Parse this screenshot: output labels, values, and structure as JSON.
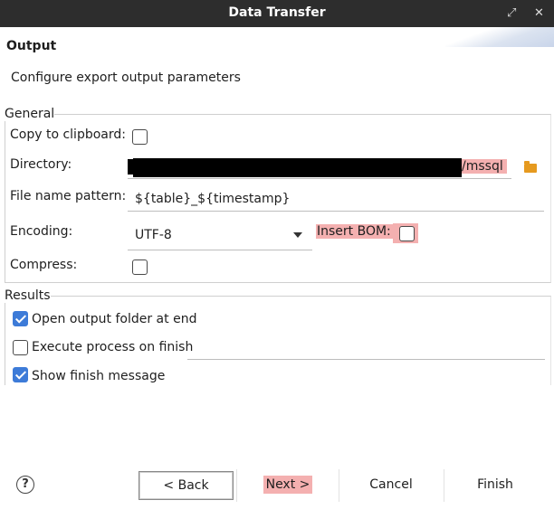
{
  "window": {
    "title": "Data Transfer",
    "icons": [
      "restore-icon",
      "close-icon"
    ]
  },
  "header": {
    "title": "Output",
    "description": "Configure export output parameters"
  },
  "general": {
    "legend": "General",
    "copy_to_clipboard": {
      "label": "Copy to clipboard:",
      "checked": false
    },
    "directory": {
      "label": "Directory:",
      "value_visible": "/mssql",
      "icon": "folder-icon"
    },
    "file_name_pattern": {
      "label": "File name pattern:",
      "value": "${table}_${timestamp}"
    },
    "encoding": {
      "label": "Encoding:",
      "value": "UTF-8"
    },
    "insert_bom": {
      "label": "Insert BOM:",
      "checked": false
    },
    "compress": {
      "label": "Compress:",
      "checked": false
    }
  },
  "results": {
    "legend": "Results",
    "open_output_folder": {
      "label": "Open output folder at end",
      "checked": true
    },
    "execute_process": {
      "label": "Execute process on finish",
      "checked": false,
      "command": ""
    },
    "show_finish_message": {
      "label": "Show finish message",
      "checked": true
    }
  },
  "footer": {
    "help_icon": "help-icon",
    "help_glyph": "?",
    "back_label": "< Back",
    "next_label": "Next >",
    "cancel_label": "Cancel",
    "finish_label": "Finish"
  },
  "colors": {
    "titlebar": "#2d2d2d",
    "highlight": "#f4b0b0",
    "checkbox_checked": "#3d7bd8",
    "folder_icon": "#e69a1f"
  }
}
